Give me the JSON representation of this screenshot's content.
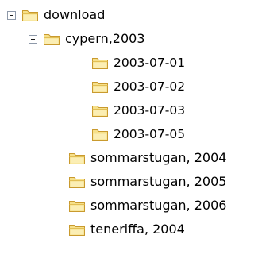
{
  "tree": {
    "root": {
      "label": "download",
      "expanded": true,
      "children": {
        "cypern": {
          "label": "cypern,2003",
          "expanded": true,
          "children": [
            {
              "label": "2003-07-01"
            },
            {
              "label": "2003-07-02"
            },
            {
              "label": "2003-07-03"
            },
            {
              "label": "2003-07-05"
            }
          ]
        },
        "others": [
          {
            "label": "sommarstugan, 2004"
          },
          {
            "label": "sommarstugan, 2005"
          },
          {
            "label": "sommarstugan, 2006"
          },
          {
            "label": "teneriffa, 2004"
          }
        ]
      }
    }
  },
  "icons": {
    "folder": "folder-icon",
    "collapse": "collapse-toggle-icon"
  },
  "colors": {
    "folder_fill": "#f6e08a",
    "folder_outline": "#c99a2e",
    "toggle_border": "#8e99a9"
  }
}
